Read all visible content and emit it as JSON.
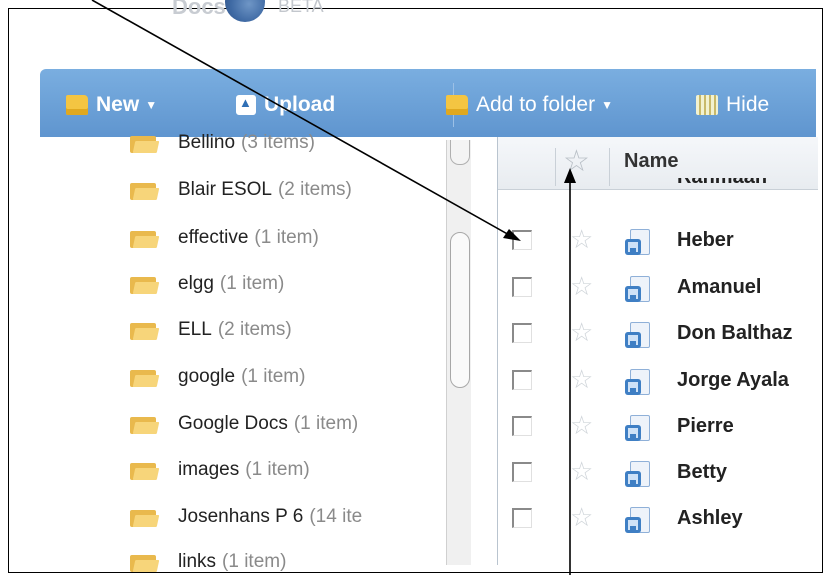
{
  "toolbar": {
    "new_label": "New",
    "upload_label": "Upload",
    "add_to_folder_label": "Add to folder",
    "hide_label": "Hide"
  },
  "folders": [
    {
      "name": "Bellino",
      "count": "(3 items)"
    },
    {
      "name": "Blair ESOL",
      "count": "(2 items)"
    },
    {
      "name": "effective",
      "count": "(1 item)"
    },
    {
      "name": "elgg",
      "count": "(1 item)"
    },
    {
      "name": "ELL",
      "count": "(2 items)"
    },
    {
      "name": "google",
      "count": "(1 item)"
    },
    {
      "name": "Google Docs",
      "count": "(1 item)"
    },
    {
      "name": "images",
      "count": "(1 item)"
    },
    {
      "name": "Josenhans P 6",
      "count": "(14 ite"
    },
    {
      "name": "links",
      "count": "(1 item)"
    }
  ],
  "list_header": {
    "name_label": "Name"
  },
  "documents": [
    {
      "name": "Rahmaan"
    },
    {
      "name": "Heber"
    },
    {
      "name": "Amanuel"
    },
    {
      "name": "Don Balthaz"
    },
    {
      "name": "Jorge Ayala"
    },
    {
      "name": "Pierre"
    },
    {
      "name": "Betty"
    },
    {
      "name": "Ashley"
    }
  ]
}
